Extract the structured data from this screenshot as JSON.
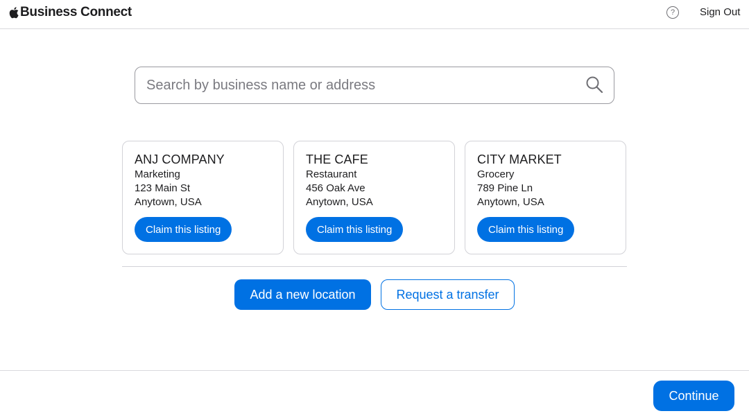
{
  "header": {
    "brand_name": "Business Connect",
    "logo_icon": "apple-logo-icon",
    "help_label": "?",
    "signout_label": "Sign Out"
  },
  "search": {
    "placeholder": "Search by business name or address",
    "value": "",
    "icon": "search-icon"
  },
  "listings": [
    {
      "name": "ANJ COMPANY",
      "category": "Marketing",
      "street": "123 Main St",
      "city": "Anytown, USA",
      "claim_label": "Claim this listing"
    },
    {
      "name": "THE CAFE",
      "category": "Restaurant",
      "street": "456 Oak Ave",
      "city": "Anytown, USA",
      "claim_label": "Claim this listing"
    },
    {
      "name": "CITY MARKET",
      "category": "Grocery",
      "street": "789 Pine Ln",
      "city": "Anytown, USA",
      "claim_label": "Claim this listing"
    }
  ],
  "actions": {
    "add_location_label": "Add a new location",
    "request_transfer_label": "Request a transfer"
  },
  "footer": {
    "continue_label": "Continue"
  },
  "colors": {
    "accent": "#0071e3",
    "text": "#1d1d1f",
    "border": "#d2d2d7"
  }
}
